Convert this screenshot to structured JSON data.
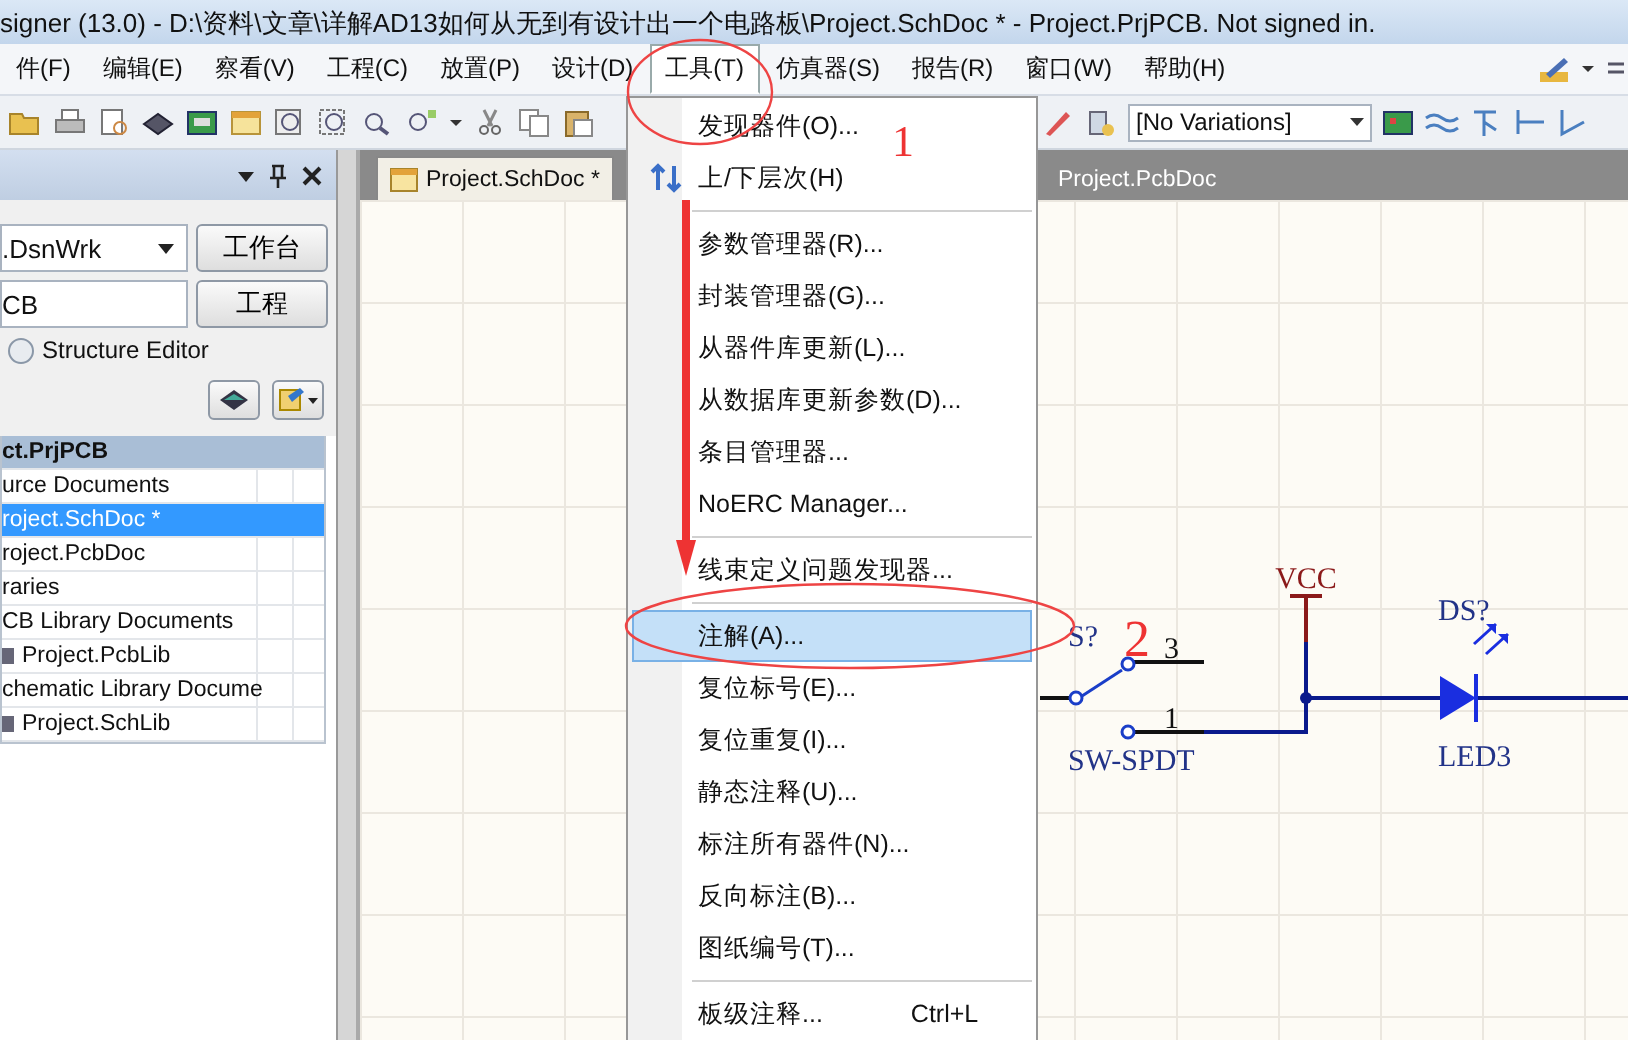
{
  "window": {
    "title": "signer (13.0) - D:\\资料\\文章\\详解AD13如何从无到有设计出一个电路板\\Project.SchDoc * - Project.PrjPCB. Not signed in."
  },
  "menu_bar": {
    "items": [
      {
        "label": "件(F)",
        "selected": false
      },
      {
        "label": "编辑(E)",
        "selected": false
      },
      {
        "label": "察看(V)",
        "selected": false
      },
      {
        "label": "工程(C)",
        "selected": false
      },
      {
        "label": "放置(P)",
        "selected": false
      },
      {
        "label": "设计(D)",
        "selected": false
      },
      {
        "label": "工具(T)",
        "selected": true
      },
      {
        "label": "仿真器(S)",
        "selected": false
      },
      {
        "label": "报告(R)",
        "selected": false
      },
      {
        "label": "窗口(W)",
        "selected": false
      },
      {
        "label": "帮助(H)",
        "selected": false
      }
    ]
  },
  "toolbar": {
    "variant_dropdown": "[No Variations]"
  },
  "projects_panel": {
    "workspace": ".DsnWrk",
    "workspace_button": "工作台",
    "project": "CB",
    "project_button": "工程",
    "structure_editor": {
      "label": "Structure Editor",
      "selected": false
    },
    "tree": [
      {
        "label": "ct.PrjPCB",
        "kind": "project",
        "selected": false
      },
      {
        "label": "urce Documents",
        "kind": "folder",
        "selected": false
      },
      {
        "label": "roject.SchDoc *",
        "kind": "document",
        "selected": true
      },
      {
        "label": "roject.PcbDoc",
        "kind": "document",
        "selected": false
      },
      {
        "label": "raries",
        "kind": "folder",
        "selected": false
      },
      {
        "label": "CB Library Documents",
        "kind": "folder",
        "selected": false
      },
      {
        "label": "Project.PcbLib",
        "kind": "library",
        "selected": false
      },
      {
        "label": "chematic Library Docume",
        "kind": "folder",
        "selected": false
      },
      {
        "label": "Project.SchLib",
        "kind": "library",
        "selected": false
      }
    ]
  },
  "document_tabs": [
    {
      "label": "Project.SchDoc *",
      "selected": true
    },
    {
      "label": "Project.PcbDoc",
      "selected": false
    }
  ],
  "schematic": {
    "switch_designator": "S?",
    "switch_pins": [
      "3",
      "1"
    ],
    "switch_comment": "SW-SPDT",
    "power_port": "VCC",
    "led_designator": "DS?",
    "led_comment": "LED3"
  },
  "tools_menu": {
    "items": [
      {
        "kind": "item",
        "label": "发现器件(O)...",
        "icon": false,
        "selected": false
      },
      {
        "kind": "item",
        "label": "上/下层次(H)",
        "icon": true,
        "selected": false
      },
      {
        "kind": "separator"
      },
      {
        "kind": "item",
        "label": "参数管理器(R)...",
        "icon": false,
        "selected": false
      },
      {
        "kind": "item",
        "label": "封装管理器(G)...",
        "icon": false,
        "selected": false
      },
      {
        "kind": "item",
        "label": "从器件库更新(L)...",
        "icon": false,
        "selected": false
      },
      {
        "kind": "item",
        "label": "从数据库更新参数(D)...",
        "icon": false,
        "selected": false
      },
      {
        "kind": "item",
        "label": "条目管理器...",
        "icon": false,
        "selected": false
      },
      {
        "kind": "item",
        "label": "NoERC Manager...",
        "icon": false,
        "selected": false
      },
      {
        "kind": "separator"
      },
      {
        "kind": "item",
        "label": "线束定义问题发现器...",
        "icon": false,
        "selected": false
      },
      {
        "kind": "separator"
      },
      {
        "kind": "item",
        "label": "注解(A)...",
        "icon": false,
        "selected": true
      },
      {
        "kind": "item",
        "label": "复位标号(E)...",
        "icon": false,
        "selected": false
      },
      {
        "kind": "item",
        "label": "复位重复(I)...",
        "icon": false,
        "selected": false
      },
      {
        "kind": "item",
        "label": "静态注释(U)...",
        "icon": false,
        "selected": false
      },
      {
        "kind": "item",
        "label": "标注所有器件(N)...",
        "icon": false,
        "selected": false
      },
      {
        "kind": "item",
        "label": "反向标注(B)...",
        "icon": false,
        "selected": false
      },
      {
        "kind": "item",
        "label": "图纸编号(T)...",
        "icon": false,
        "selected": false
      },
      {
        "kind": "separator"
      },
      {
        "kind": "item",
        "label": "板级注释...",
        "shortcut": "Ctrl+L",
        "icon": false,
        "selected": false
      }
    ]
  },
  "annotations": {
    "step_labels": [
      "1",
      "2"
    ]
  }
}
